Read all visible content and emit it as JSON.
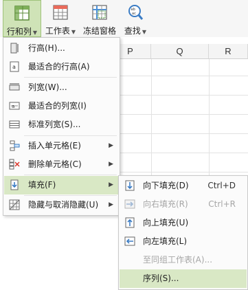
{
  "ribbon": {
    "buttons": [
      {
        "label": "行和列",
        "icon": "rows-columns-icon",
        "dropdown": true,
        "active": true
      },
      {
        "label": "工作表",
        "icon": "worksheet-icon",
        "dropdown": true,
        "active": false
      },
      {
        "label": "冻结窗格",
        "icon": "freeze-panes-icon",
        "dropdown": false,
        "active": false
      },
      {
        "label": "查找",
        "icon": "find-icon",
        "dropdown": true,
        "active": false
      }
    ]
  },
  "grid": {
    "columns": [
      "P",
      "Q",
      "R"
    ]
  },
  "menu": {
    "items": [
      {
        "label": "行高(H)...",
        "icon": "row-height-icon"
      },
      {
        "label": "最适合的行高(A)",
        "icon": "autofit-row-height-icon"
      },
      {
        "label": "列宽(W)...",
        "icon": "column-width-icon"
      },
      {
        "label": "最适合的列宽(I)",
        "icon": "autofit-column-width-icon"
      },
      {
        "label": "标准列宽(S)...",
        "icon": "standard-width-icon"
      },
      {
        "label": "插入单元格(E)",
        "icon": "insert-cells-icon",
        "submenu": true
      },
      {
        "label": "删除单元格(C)",
        "icon": "delete-cells-icon",
        "submenu": true
      },
      {
        "label": "填充(F)",
        "icon": "fill-icon",
        "submenu": true,
        "highlighted": true
      },
      {
        "label": "隐藏与取消隐藏(U)",
        "icon": "hide-unhide-icon",
        "submenu": true
      }
    ]
  },
  "submenu": {
    "items": [
      {
        "label": "向下填充(D)",
        "shortcut": "Ctrl+D",
        "icon": "fill-down-icon",
        "enabled": true
      },
      {
        "label": "向右填充(R)",
        "shortcut": "Ctrl+R",
        "icon": "fill-right-icon",
        "enabled": false
      },
      {
        "label": "向上填充(U)",
        "shortcut": "",
        "icon": "fill-up-icon",
        "enabled": true
      },
      {
        "label": "向左填充(L)",
        "shortcut": "",
        "icon": "fill-left-icon",
        "enabled": true
      },
      {
        "label": "至同组工作表(A)...",
        "shortcut": "",
        "icon": "",
        "enabled": false
      },
      {
        "label": "序列(S)...",
        "shortcut": "",
        "icon": "",
        "enabled": true,
        "highlighted": true
      }
    ]
  },
  "colors": {
    "active_button_bg": "#cfe3b7",
    "highlight_bg": "#d9e8c5",
    "disabled_text": "#a6a6a6"
  }
}
